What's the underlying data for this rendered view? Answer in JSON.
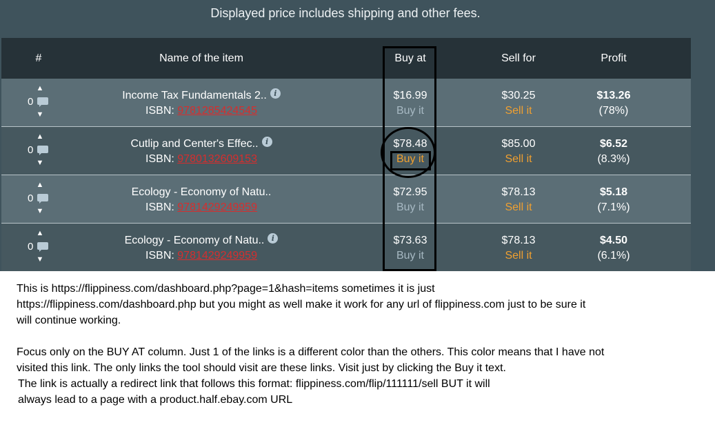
{
  "notice": "Displayed price includes shipping and other fees.",
  "headers": {
    "num": "#",
    "name": "Name of the item",
    "buy": "Buy at",
    "sell": "Sell for",
    "profit": "Profit"
  },
  "rows": [
    {
      "votes": "0",
      "title": "Income Tax Fundamentals 2..",
      "has_info": true,
      "isbn_label": "ISBN:",
      "isbn": "9781285424545",
      "buy_price": "$16.99",
      "buy_link": "Buy it",
      "sell_price": "$30.25",
      "sell_link": "Sell it",
      "profit": "$13.26",
      "profit_pct": "(78%)"
    },
    {
      "votes": "0",
      "title": "Cutlip and Center's Effec..",
      "has_info": true,
      "isbn_label": "ISBN:",
      "isbn": "9780132609153",
      "buy_price": "$78.48",
      "buy_link": "Buy it",
      "buy_unvisited": true,
      "sell_price": "$85.00",
      "sell_link": "Sell it",
      "profit": "$6.52",
      "profit_pct": "(8.3%)"
    },
    {
      "votes": "0",
      "title": "Ecology - Economy of Natu..",
      "has_info": false,
      "isbn_label": "ISBN:",
      "isbn": "9781429249959",
      "buy_price": "$72.95",
      "buy_link": "Buy it",
      "sell_price": "$78.13",
      "sell_link": "Sell it",
      "profit": "$5.18",
      "profit_pct": "(7.1%)"
    },
    {
      "votes": "0",
      "title": "Ecology - Economy of Natu..",
      "has_info": true,
      "isbn_label": "ISBN:",
      "isbn": "9781429249959",
      "buy_price": "$73.63",
      "buy_link": "Buy it",
      "sell_price": "$78.13",
      "sell_link": "Sell it",
      "profit": "$4.50",
      "profit_pct": "(6.1%)"
    }
  ],
  "notes": {
    "p1_l1": "This is https://flippiness.com/dashboard.php?page=1&hash=items sometimes it is just",
    "p1_l2": "https://flippiness.com/dashboard.php but you might as well make it work for any url of flippiness.com just to be sure it",
    "p1_l3": "will continue working.",
    "p2_l1": "Focus only on the BUY AT column. Just 1 of the links is a different color than the others. This color means that I have not",
    "p2_l2": "visited this link. The only links the tool should visit are these links. Visit just by clicking the Buy it text.",
    "p3_l1": "The link is actually a redirect link that follows this format: flippiness.com/flip/111111/sell BUT it will",
    "p3_l2": "always lead to a page with a product.half.ebay.com URL"
  },
  "colors": {
    "page_bg": "#3f535c",
    "header_bg": "#263238",
    "row_light": "#5b6e76",
    "row_dark": "#46585f",
    "isbn_link": "#d62e2e",
    "visited_link": "#a7b9c3",
    "unvisited_link": "#f0a030"
  },
  "icons": [
    "arrow-up-icon",
    "comment-icon",
    "arrow-down-icon",
    "info-icon"
  ]
}
